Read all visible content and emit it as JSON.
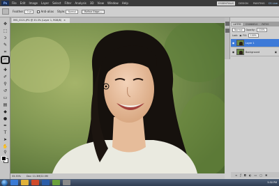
{
  "app": {
    "logo": "Ps",
    "menus": [
      "File",
      "Edit",
      "Image",
      "Layer",
      "Select",
      "Filter",
      "Analysis",
      "3D",
      "View",
      "Window",
      "Help"
    ],
    "workspaces": [
      "ESSENTIALS",
      "DESIGN",
      "PAINTING"
    ],
    "active_workspace": "ESSENTIALS",
    "cs_live": "CS Live"
  },
  "options": {
    "feather_label": "Feather:",
    "feather_value": "0 px",
    "antialias_label": "Anti-alias",
    "style_label": "Style:",
    "style_value": "Normal",
    "refine_edge": "Refine Edge..."
  },
  "document": {
    "tab_title": "IMG_0221.JPG @ 33.3% (Layer 1, RGB/8)",
    "zoom": "33.33%",
    "doc_size": "Doc: 11.3M/22.5M"
  },
  "panels": {
    "tabs": [
      "LAYERS",
      "CHANNELS",
      "PATHS"
    ],
    "blend_mode": "Normal",
    "opacity_label": "Opacity:",
    "opacity_value": "100%",
    "lock_label": "Lock:",
    "fill_label": "Fill:",
    "fill_value": "100%",
    "layers": [
      {
        "name": "Layer 1",
        "selected": true
      },
      {
        "name": "Background",
        "selected": false
      }
    ]
  },
  "taskbar": {
    "clock": "5:50 PM"
  },
  "colors": {
    "accent": "#3d7ad8",
    "ui_dark": "#3a3a3a",
    "ui_light": "#cfcfcf"
  }
}
